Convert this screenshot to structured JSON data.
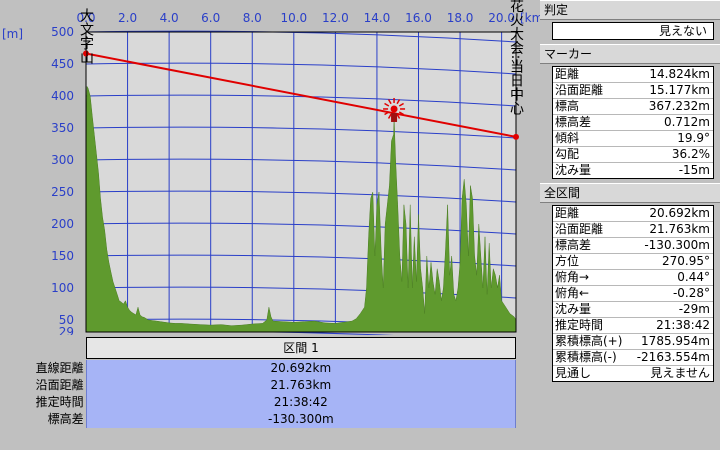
{
  "chart_data": {
    "type": "area",
    "title": "",
    "xlabel": "[km]",
    "ylabel": "[m]",
    "x_ticks": [
      "0.0",
      "2.0",
      "4.0",
      "6.0",
      "8.0",
      "10.0",
      "12.0",
      "14.0",
      "16.0",
      "18.0",
      "20.0"
    ],
    "y_ticks": [
      "500",
      "450",
      "400",
      "350",
      "300",
      "250",
      "200",
      "150",
      "100",
      "50",
      "29"
    ],
    "xlim": [
      0,
      20.692
    ],
    "ylim": [
      29,
      500
    ],
    "start_label": "大文字山",
    "end_label": "保津川花火大会:当日中心",
    "series": [
      {
        "x": [
          0.0,
          0.05,
          0.1,
          0.2,
          0.3,
          0.4,
          0.5,
          0.6,
          0.7,
          0.8,
          0.9,
          1.0,
          1.1,
          1.2,
          1.3,
          1.4,
          1.5,
          1.6,
          1.7,
          1.8,
          1.9,
          2.0,
          2.1,
          2.2,
          2.3,
          2.4,
          2.5,
          2.6,
          2.7,
          2.8,
          2.9,
          3.0,
          3.2,
          3.4,
          3.6,
          3.8,
          4.0,
          4.3,
          4.6,
          5.0,
          5.5,
          6.0,
          6.5,
          7.0,
          7.5,
          8.0,
          8.5,
          8.7,
          8.8,
          8.9,
          9.0,
          9.5,
          10.0,
          10.5,
          11.0,
          11.5,
          12.0,
          12.4,
          12.8,
          13.0,
          13.2,
          13.4,
          13.5,
          13.6,
          13.7,
          13.8,
          13.9,
          14.0,
          14.1,
          14.2,
          14.3,
          14.4,
          14.5,
          14.6,
          14.7,
          14.8,
          14.824,
          14.9,
          15.0,
          15.1,
          15.2,
          15.3,
          15.4,
          15.5,
          15.6,
          15.7,
          15.8,
          15.9,
          16.0,
          16.1,
          16.2,
          16.3,
          16.4,
          16.5,
          16.6,
          16.7,
          16.8,
          16.9,
          17.0,
          17.1,
          17.2,
          17.3,
          17.4,
          17.5,
          17.6,
          17.7,
          17.8,
          17.9,
          18.0,
          18.1,
          18.2,
          18.3,
          18.4,
          18.5,
          18.6,
          18.7,
          18.8,
          18.9,
          19.0,
          19.1,
          19.2,
          19.3,
          19.4,
          19.5,
          19.6,
          19.7,
          19.8,
          19.9,
          20.0,
          20.2,
          20.4,
          20.6,
          20.692
        ],
        "y": [
          300,
          415,
          412,
          400,
          370,
          340,
          310,
          280,
          240,
          210,
          190,
          160,
          140,
          125,
          110,
          100,
          90,
          80,
          78,
          75,
          80,
          70,
          65,
          62,
          60,
          58,
          70,
          58,
          55,
          54,
          52,
          50,
          49,
          48,
          47,
          46,
          45,
          44,
          44,
          43,
          42,
          41,
          42,
          40,
          41,
          43,
          44,
          50,
          70,
          55,
          48,
          47,
          46,
          47,
          48,
          45,
          44,
          46,
          48,
          52,
          60,
          70,
          100,
          180,
          240,
          250,
          150,
          230,
          250,
          160,
          100,
          200,
          230,
          260,
          330,
          340,
          367.232,
          300,
          230,
          150,
          110,
          230,
          200,
          100,
          230,
          100,
          180,
          110,
          215,
          130,
          100,
          60,
          150,
          100,
          140,
          110,
          90,
          130,
          110,
          80,
          100,
          160,
          230,
          120,
          150,
          90,
          80,
          100,
          140,
          240,
          270,
          230,
          150,
          260,
          240,
          150,
          120,
          200,
          150,
          100,
          180,
          90,
          170,
          100,
          130,
          120,
          100,
          120,
          80,
          70,
          60,
          55,
          50
        ]
      }
    ],
    "line_of_sight": {
      "y_start": 466.4,
      "y_end": 336.1
    },
    "marker": {
      "x": 14.824,
      "y": 367.232
    }
  },
  "bottom": {
    "section_label": "区間 1",
    "rows": [
      {
        "label": "直線距離",
        "value": "20.692km"
      },
      {
        "label": "沿面距離",
        "value": "21.763km"
      },
      {
        "label": "推定時間",
        "value": "21:38:42"
      },
      {
        "label": "標高差",
        "value": "-130.300m"
      }
    ]
  },
  "panel": {
    "judge_title": "判定",
    "judge_value": "見えない",
    "marker_title": "マーカー",
    "marker_rows": [
      {
        "k": "距離",
        "v": "14.824km"
      },
      {
        "k": "沿面距離",
        "v": "15.177km"
      },
      {
        "k": "標高",
        "v": "367.232m"
      },
      {
        "k": "標高差",
        "v": "0.712m"
      },
      {
        "k": "傾斜",
        "v": "19.9°"
      },
      {
        "k": "勾配",
        "v": "36.2%"
      },
      {
        "k": "沈み量",
        "v": "-15m"
      }
    ],
    "total_title": "全区間",
    "total_rows": [
      {
        "k": "距離",
        "v": "20.692km"
      },
      {
        "k": "沿面距離",
        "v": "21.763km"
      },
      {
        "k": "標高差",
        "v": "-130.300m"
      },
      {
        "k": "方位",
        "v": "270.95°"
      },
      {
        "k": "俯角→",
        "v": "0.44°"
      },
      {
        "k": "俯角←",
        "v": "-0.28°"
      },
      {
        "k": "沈み量",
        "v": "-29m"
      },
      {
        "k": "推定時間",
        "v": "21:38:42"
      },
      {
        "k": "累積標高(+)",
        "v": "1785.954m"
      },
      {
        "k": "累積標高(-)",
        "v": "-2163.554m"
      },
      {
        "k": "見通し",
        "v": "見えません"
      }
    ]
  },
  "colors": {
    "terrain": "#5f9a2e",
    "line": "#e00000",
    "grid": "#2a3fc8",
    "plot_bg": "#d9d9d9",
    "value_bg": "#a6b4f6"
  }
}
